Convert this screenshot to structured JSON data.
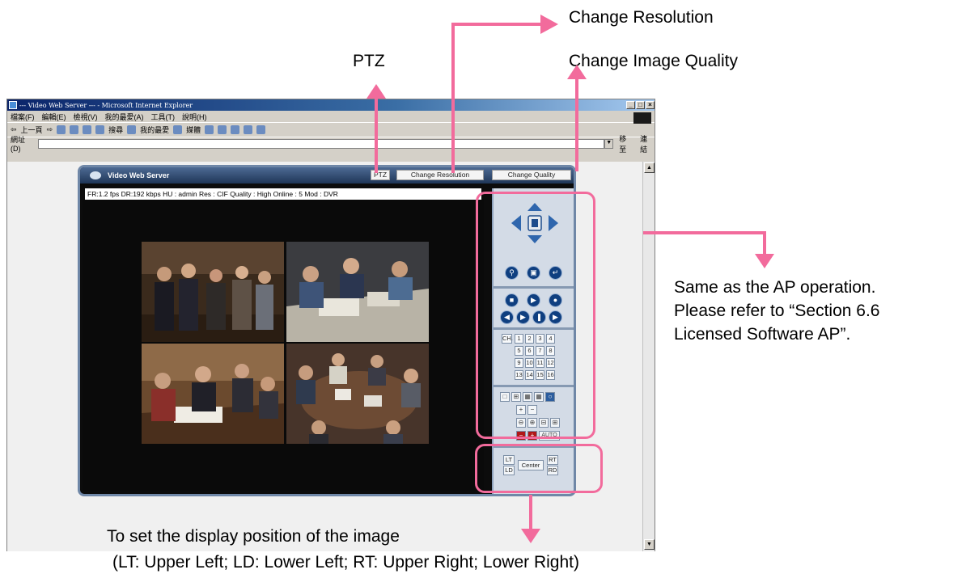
{
  "callouts": {
    "ptz": "PTZ",
    "change_resolution": "Change Resolution",
    "change_image_quality": "Change Image Quality",
    "ap_note_line1": "Same as the AP operation.",
    "ap_note_line2": "Please refer to “Section 6.6",
    "ap_note_line3": "Licensed Software AP”.",
    "position_note_line1": "To set the display position of the  image",
    "position_note_line2": "(LT: Upper Left; LD: Lower Left; RT: Upper Right; Lower Right)"
  },
  "browser": {
    "window_title": "--- Video Web Server --- - Microsoft Internet Explorer",
    "menu": [
      "檔案(F)",
      "編輯(E)",
      "檢視(V)",
      "我的最愛(A)",
      "工具(T)",
      "說明(H)"
    ],
    "back_label": "上一頁",
    "search_label": "搜尋",
    "favorites_label": "我的最愛",
    "media_label": "媒體",
    "address_label": "網址(D)",
    "go_label": "移至",
    "links_label": "連結"
  },
  "app": {
    "title": "Video Web Server",
    "ptz_button": "PTZ",
    "change_resolution_button": "Change Resolution",
    "change_quality_button": "Change Quality",
    "status_bar": "FR:1.2 fps  DR:192 kbps  HU : admin  Res : CIF  Quality : High  Online : 5 Mod : DVR",
    "channel_label": "CH.",
    "channels": [
      "1",
      "2",
      "3",
      "4",
      "5",
      "6",
      "7",
      "8",
      "9",
      "10",
      "11",
      "12",
      "13",
      "14",
      "15",
      "16"
    ],
    "auto_label": "AUTO",
    "position_buttons": {
      "lt": "LT",
      "ld": "LD",
      "rt": "RT",
      "rd": "RD",
      "center": "Center"
    }
  },
  "colors": {
    "callout_pink": "#f26b9c",
    "app_header": "#1f3657",
    "panel_bg": "#d3dbe6",
    "button_blue": "#0f3f80"
  }
}
